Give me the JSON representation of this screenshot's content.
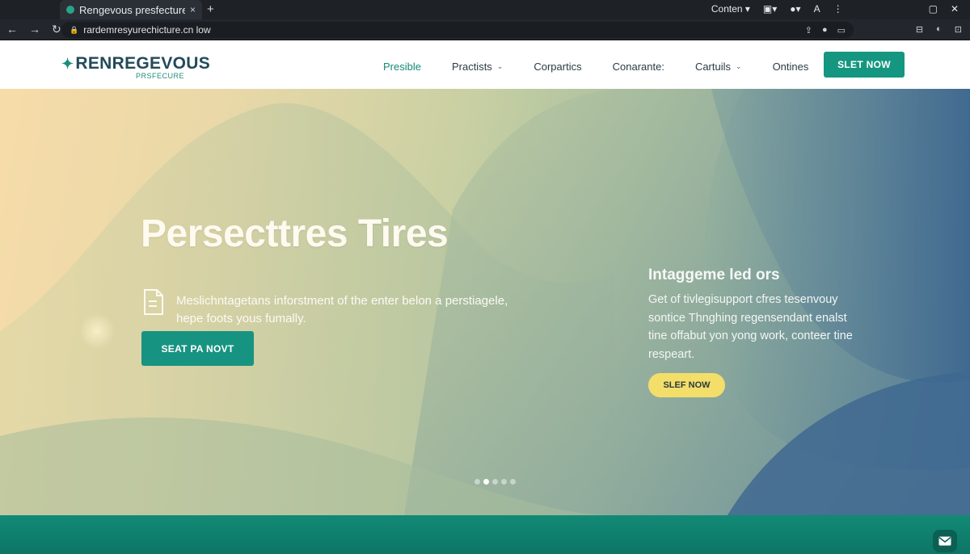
{
  "browser": {
    "tab_title": "Rengevous presfecture",
    "tab_close": "×",
    "new_tab": "+",
    "content_menu": "Conten",
    "font_label": "A",
    "url": "rardemresyurechicture.cn low"
  },
  "site": {
    "logo_text": "RENREGEVOUS",
    "logo_sub": "PRSFECURE",
    "nav": [
      {
        "label": "Presible"
      },
      {
        "label": "Practists"
      },
      {
        "label": "Corpartics"
      },
      {
        "label": "Conarante:"
      },
      {
        "label": "Cartuils"
      },
      {
        "label": "Ontines"
      }
    ],
    "cta_top": "SLET NOW"
  },
  "hero": {
    "title": "Persecttres Tires",
    "description": "Meslichntagetans inforstment of the enter belon a perstiagele, hepe foots yous fumally.",
    "button": "SEAT PA NOVT",
    "side_title": "Intaggeme led ors",
    "side_text": "Get of tivlegisupport cfres tesenvouy sontice Thnghing regensendant enalst tine offabut yon yong work, conteer tine respeart.",
    "side_button": "SLEF NOW",
    "carousel_total": 5,
    "carousel_active": 1
  },
  "colors": {
    "brand_teal": "#159680",
    "accent_yellow": "#f3de6a",
    "logo_navy": "#234a5a"
  }
}
